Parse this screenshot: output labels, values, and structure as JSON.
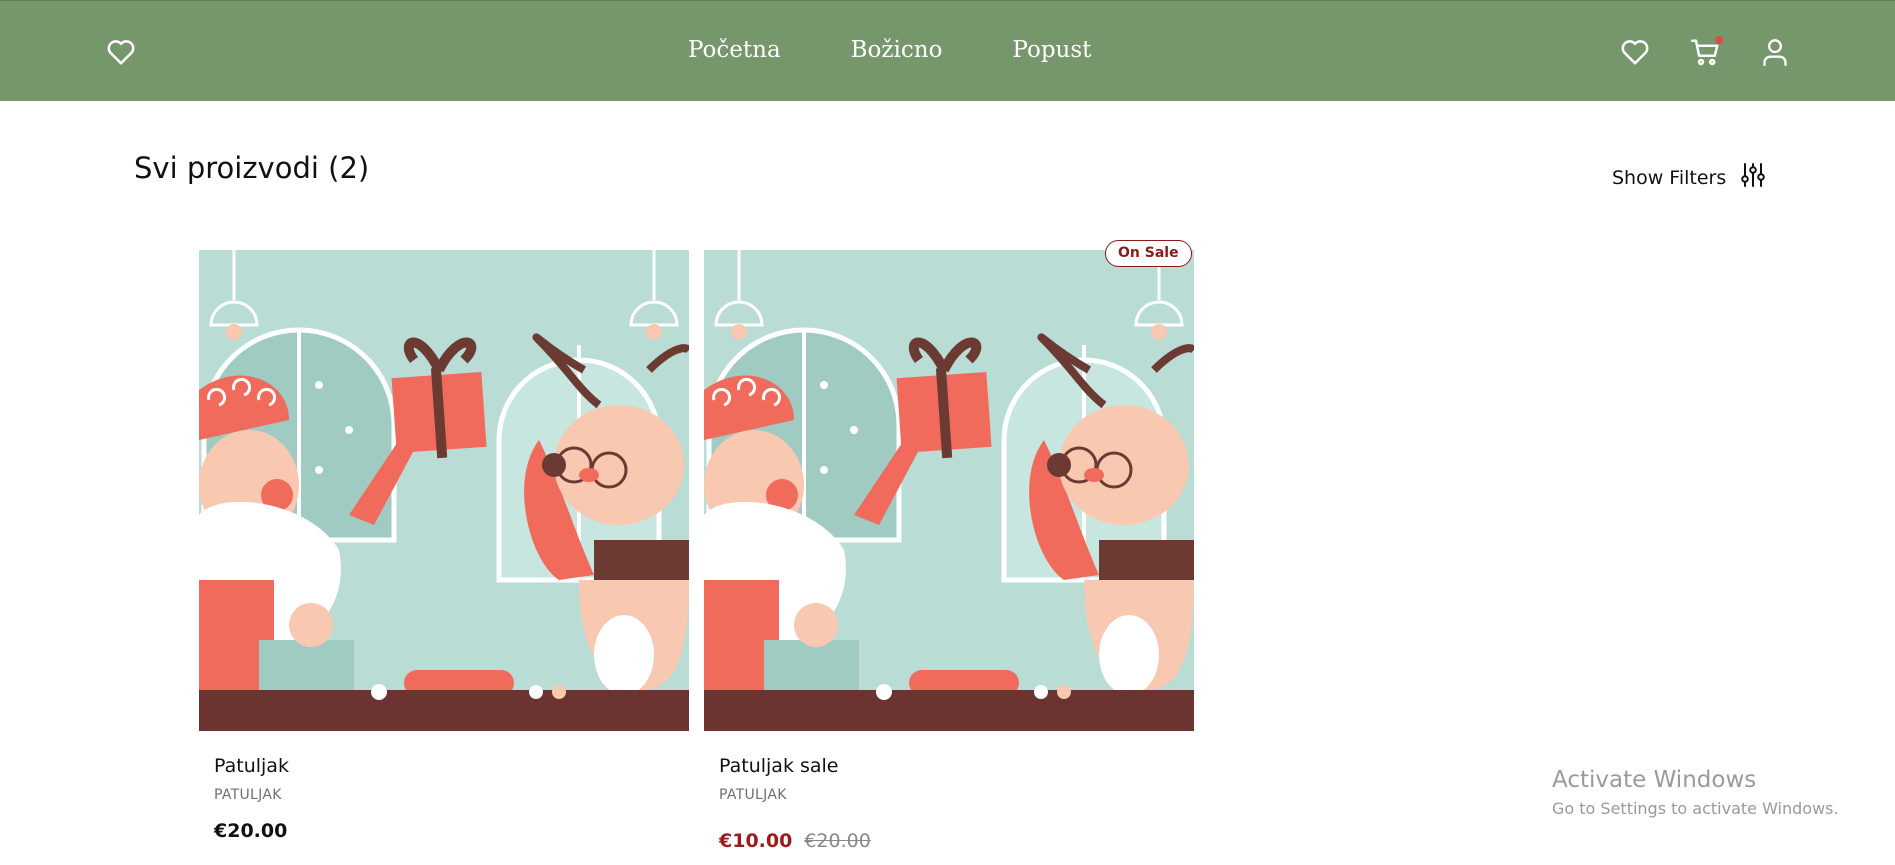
{
  "header": {
    "logo_icon": "heart-outline-icon",
    "nav": [
      {
        "label": "Početna"
      },
      {
        "label": "Božicno"
      },
      {
        "label": "Popust"
      }
    ],
    "right_icons": [
      "heart-outline-icon",
      "cart-icon",
      "user-icon"
    ],
    "cart_has_items": true,
    "colors": {
      "navbar": "#76966c",
      "cart_dot": "#e04848"
    }
  },
  "main": {
    "title": "Svi proizvodi (2)",
    "filter_label": "Show Filters",
    "filter_icon": "sliders-icon"
  },
  "products": [
    {
      "name": "Patuljak",
      "category": "PATULJAK",
      "price": "€20.00"
    },
    {
      "name": "Patuljak sale",
      "category": "PATULJAK",
      "badge": "On Sale",
      "sale_price": "€10.00",
      "original_price": "€20.00"
    }
  ],
  "watermark": {
    "title": "Activate Windows",
    "subtitle": "Go to Settings to activate Windows."
  },
  "colors": {
    "sale": "#9b1c1c",
    "image_bg": "#b9dcd5"
  }
}
